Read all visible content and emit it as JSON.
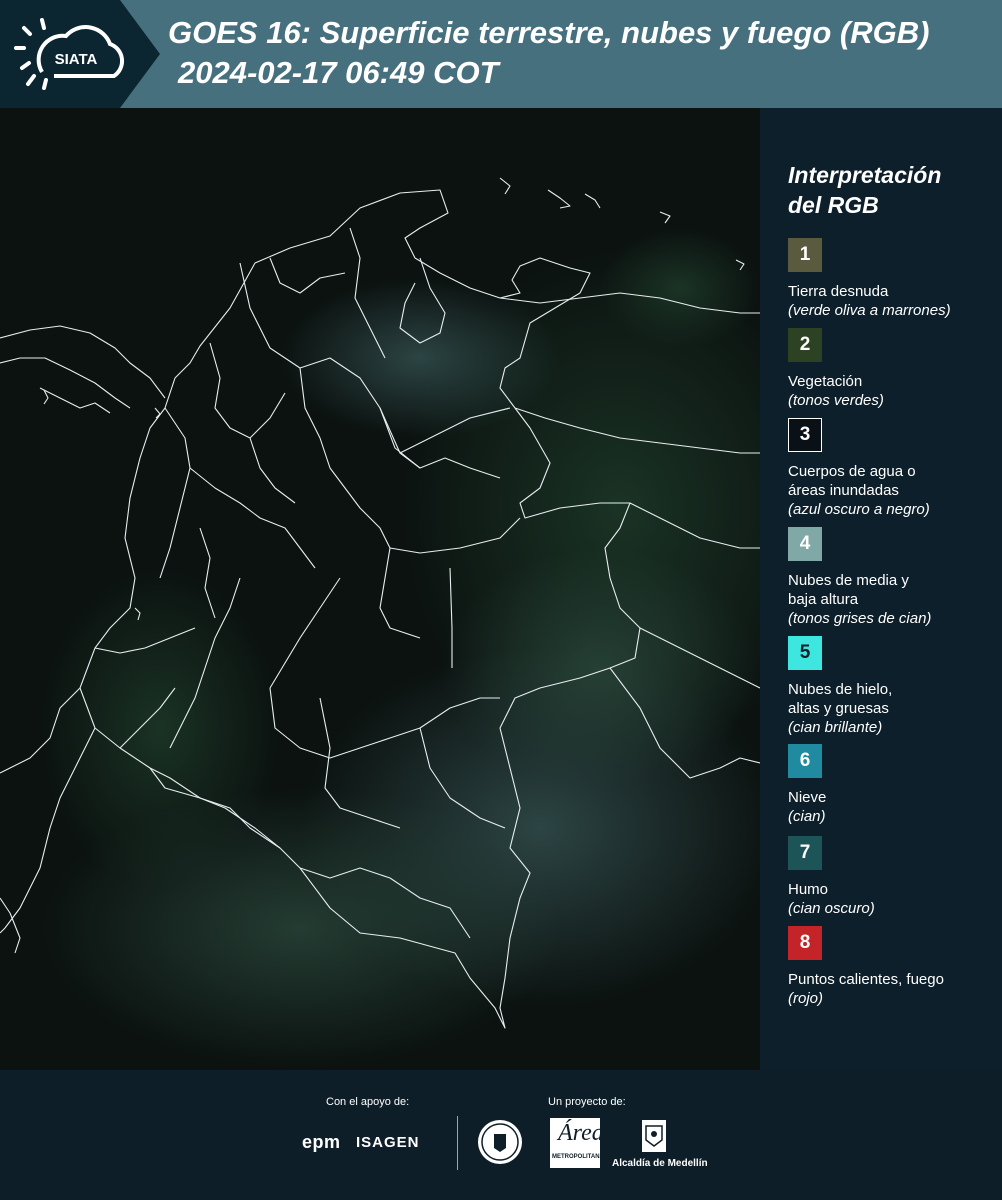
{
  "header": {
    "logo_text": "SIATA",
    "title_line1": "GOES 16: Superficie terrestre, nubes y fuego (RGB)",
    "title_line2": "2024-02-17 06:49 COT"
  },
  "legend": {
    "title": "Interpretación del RGB",
    "items": [
      {
        "num": "1",
        "label": "Tierra desnuda",
        "sub": "(verde oliva a marrones)",
        "color": "#5a5a3e",
        "text_color": "#ffffff"
      },
      {
        "num": "2",
        "label": "Vegetación",
        "sub": "(tonos verdes)",
        "color": "#2d4222",
        "text_color": "#ffffff"
      },
      {
        "num": "3",
        "label": "Cuerpos de agua o áreas inundadas",
        "sub": "(azul oscuro a negro)",
        "color": "#0a1116",
        "text_color": "#ffffff"
      },
      {
        "num": "4",
        "label": "Nubes de media y baja altura",
        "sub": "(tonos grises de cian)",
        "color": "#7fa8a6",
        "text_color": "#ffffff"
      },
      {
        "num": "5",
        "label": "Nubes de hielo, altas y gruesas",
        "sub": "(cian brillante)",
        "color": "#3ee6e0",
        "text_color": "#0d1f2a"
      },
      {
        "num": "6",
        "label": "Nieve",
        "sub": "(cian)",
        "color": "#1f8aa0",
        "text_color": "#ffffff"
      },
      {
        "num": "7",
        "label": "Humo",
        "sub": "(cian oscuro)",
        "color": "#1c5458",
        "text_color": "#ffffff"
      },
      {
        "num": "8",
        "label": "Puntos calientes, fuego",
        "sub": "(rojo)",
        "color": "#c42428",
        "text_color": "#ffffff"
      }
    ]
  },
  "footer": {
    "support_label": "Con el apoyo de:",
    "project_label": "Un proyecto de:",
    "epm": "epm",
    "isagen": "ISAGEN",
    "area_big": "Área",
    "area_small": "METROPOLITANA",
    "alcaldia": "Alcaldía de Medellín"
  }
}
